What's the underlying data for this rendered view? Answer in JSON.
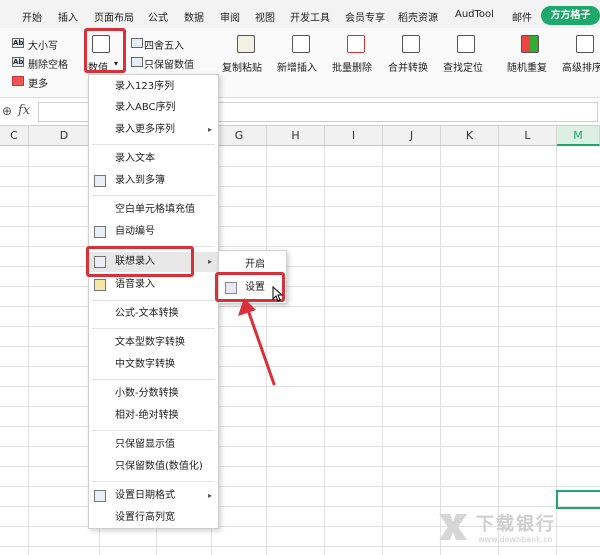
{
  "tabs": [
    "开始",
    "插入",
    "页面布局",
    "公式",
    "数据",
    "审阅",
    "视图",
    "开发工具",
    "会员专享",
    "稻壳资源",
    "AudTool",
    "邮件",
    "方方格子"
  ],
  "ribbon": {
    "size_label": "大小写",
    "remove_space_label": "删除空格",
    "more_label": "更多",
    "value_label": "数值",
    "round_label": "四舍五入",
    "keep_value_label": "只保留数值",
    "copy_paste_label": "复制粘贴",
    "insert_new_label": "新增插入",
    "batch_delete_label": "批量删除",
    "merge_convert_label": "合并转换",
    "find_locate_label": "查找定位",
    "random_repeat_label": "随机重复",
    "advanced_sort_label": "高级排序"
  },
  "formula_bar": {
    "fx": "fx"
  },
  "columns": [
    "C",
    "D",
    "E",
    "F",
    "G",
    "H",
    "I",
    "J",
    "K",
    "L",
    "M"
  ],
  "menu": {
    "items": [
      "录入123序列",
      "录入ABC序列",
      "录入更多序列",
      "录入文本",
      "录入到多簿",
      "空白单元格填充值",
      "自动编号",
      "联想录入",
      "语音录入",
      "公式-文本转换",
      "文本型数字转换",
      "中文数字转换",
      "小数-分数转换",
      "相对-绝对转换",
      "只保留显示值",
      "只保留数值(数值化)",
      "设置日期格式",
      "设置行高列宽"
    ]
  },
  "submenu": {
    "open_label": "开启",
    "settings_label": "设置"
  },
  "watermark": {
    "brand": "下载银行",
    "url": "www.downbank.cn"
  },
  "colors": {
    "accent_green": "#1ea86b",
    "highlight_red": "#d9313a"
  }
}
